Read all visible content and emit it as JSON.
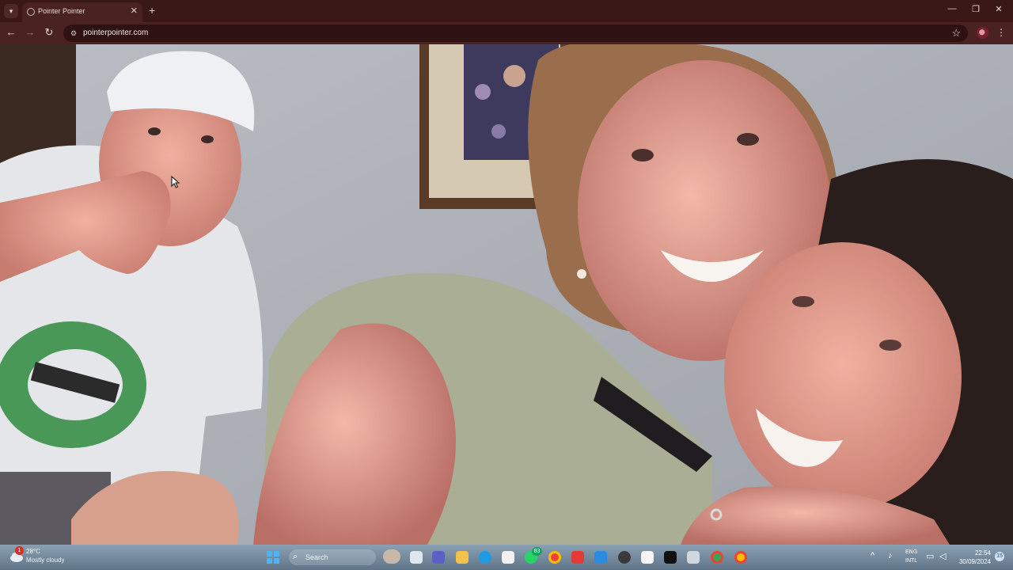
{
  "browser": {
    "tab_title": "Pointer Pointer",
    "url": "pointerpointer.com",
    "new_tab_symbol": "+",
    "close_symbol": "✕"
  },
  "taskbar": {
    "weather_temp": "28°C",
    "weather_condition": "Mostly cloudy",
    "weather_badge": "1",
    "search_label": "Search",
    "whatsapp_badge": "83",
    "language_line1": "ENG",
    "language_line2": "INTL",
    "time": "22:54",
    "date": "30/09/2024",
    "notification_count": "15"
  },
  "colors": {
    "titlebar": "#3a1818",
    "toolbar": "#4a2222",
    "omnibox": "#2e1212",
    "taskbar": "#7890a3"
  }
}
